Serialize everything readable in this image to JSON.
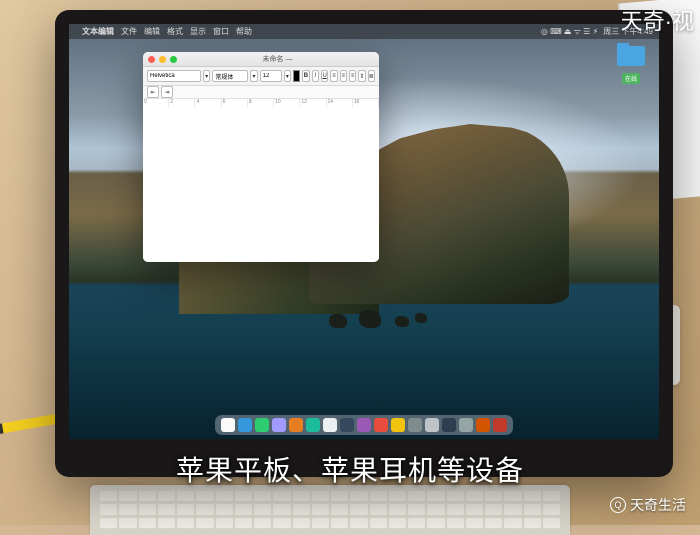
{
  "menubar": {
    "apple": "",
    "app": "文本编辑",
    "menus": [
      "文件",
      "编辑",
      "格式",
      "显示",
      "窗口",
      "帮助"
    ],
    "status": {
      "icons": "◎ ⌨ ⏏ ᯤ ☰ ⚡︎",
      "datetime": "周三 下午4:49"
    }
  },
  "desktop": {
    "folder_label": "在线"
  },
  "textedit": {
    "title": "未命名 —",
    "font_family": "Helvetica",
    "style": "常规体",
    "size": "12",
    "ruler_marks": [
      "0",
      "2",
      "4",
      "6",
      "8",
      "10",
      "12",
      "14",
      "16"
    ]
  },
  "dock_colors": [
    "#fafafa",
    "#3498db",
    "#2ecc71",
    "#a29bfe",
    "#e67e22",
    "#1abc9c",
    "#ecf0f1",
    "#34495e",
    "#9b59b6",
    "#e74c3c",
    "#f1c40f",
    "#7f8c8d",
    "#bdc3c7",
    "#2c3e50",
    "#95a5a6",
    "#d35400",
    "#c0392b"
  ],
  "caption": "苹果平板、苹果耳机等设备",
  "watermarks": {
    "top_right": "天奇·视",
    "bottom_right": "天奇生活",
    "bottom_icon": "Q"
  }
}
